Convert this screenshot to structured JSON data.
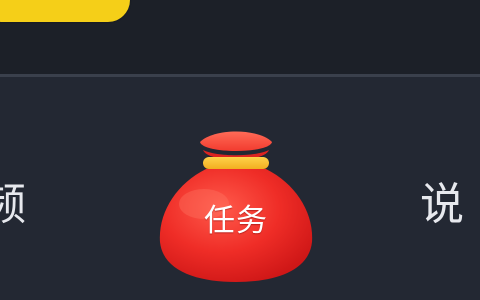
{
  "promo": {
    "label": ""
  },
  "tabs": {
    "left_label": "频",
    "center_label": "任务",
    "right_label": "说"
  },
  "icons": {
    "center_icon": "red-lucky-bag-icon"
  },
  "colors": {
    "background": "#232833",
    "divider": "#3a404c",
    "promo_yellow": "#f5cf18",
    "bag_red": "#e5221f",
    "bag_band": "#f8c12d",
    "tab_text": "#e7e9ee"
  }
}
